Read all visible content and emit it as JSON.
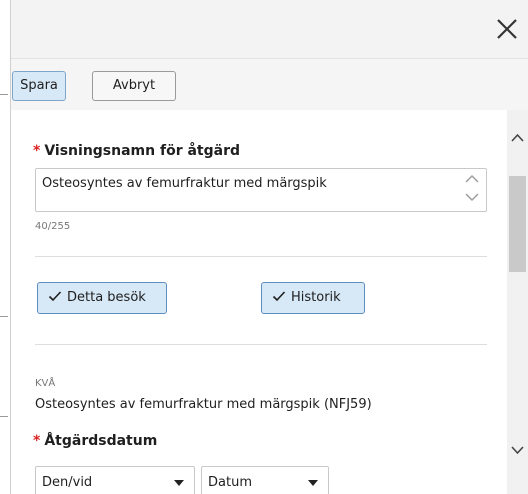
{
  "icons": {
    "close": "close-icon",
    "check": "check-icon",
    "caret": "caret-down-icon",
    "chevron_up": "chevron-up-icon",
    "chevron_down": "chevron-down-icon"
  },
  "toolbar": {
    "save_label": "Spara",
    "cancel_label": "Avbryt"
  },
  "form": {
    "display_name": {
      "required_mark": "*",
      "label": "Visningsnamn för åtgärd",
      "value": "Osteosyntes av femurfraktur med märgspik",
      "counter": "40/255"
    },
    "buttons": {
      "this_visit": "Detta besök",
      "history": "Historik"
    },
    "kva": {
      "caption": "KVÅ",
      "value": "Osteosyntes av femurfraktur med märgspik (NFJ59)"
    },
    "action_date": {
      "required_mark": "*",
      "label": "Åtgärdsdatum",
      "type_select_value": "Den/vid",
      "date_select_value": "Datum"
    }
  },
  "colors": {
    "required": "#d92323",
    "primary_button_bg": "#d7e8f6",
    "primary_button_border": "#5c8fc0",
    "toolbar_bg": "#f5f5f5",
    "scroll_thumb": "#c9c9c9"
  }
}
